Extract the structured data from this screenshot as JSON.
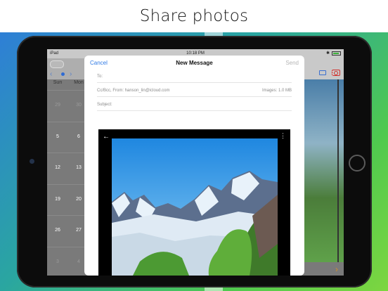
{
  "promo": {
    "title": "Share photos"
  },
  "status_bar": {
    "carrier": "iPad",
    "time": "10:18 PM"
  },
  "calendar": {
    "weekdays": [
      "Sun",
      "Mon"
    ],
    "rows": [
      [
        "29",
        "30"
      ],
      [
        "5",
        "6"
      ],
      [
        "12",
        "13"
      ],
      [
        "19",
        "20"
      ],
      [
        "26",
        "27"
      ],
      [
        "3",
        "4"
      ]
    ]
  },
  "compose": {
    "cancel_label": "Cancel",
    "title": "New Message",
    "send_label": "Send",
    "to_label": "To:",
    "cc_label": "Cc/Bcc, From: hanson_lin@icloud.com",
    "images_label": "Images: 1.0 MB",
    "subject_label": "Subject:"
  },
  "icons": {
    "back": "back-arrow-icon",
    "more": "more-icon",
    "folder": "folder-icon",
    "camera": "camera-icon",
    "chevron": "chevron-right-icon"
  },
  "colors": {
    "accent_blue": "#2f7ae5",
    "camera_red": "#d0312d",
    "chevron_orange": "#d28f2a"
  }
}
